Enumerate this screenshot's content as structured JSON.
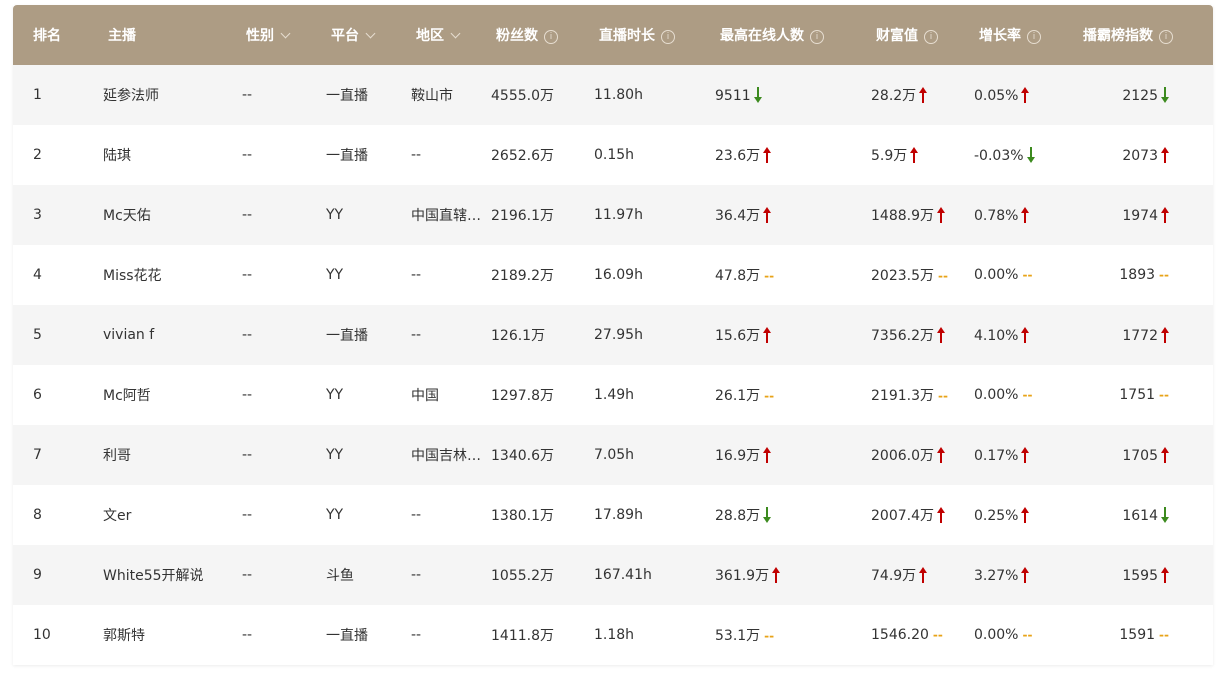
{
  "colors": {
    "header_bg": "#ad9c84",
    "up": "#c00000",
    "down": "#3c8a1e",
    "flat": "#e8a317"
  },
  "headers": {
    "rank": "排名",
    "anchor": "主播",
    "gender": "性别",
    "platform": "平台",
    "region": "地区",
    "fans": "粉丝数",
    "duration": "直播时长",
    "peak": "最高在线人数",
    "wealth": "财富值",
    "growth": "增长率",
    "index": "播霸榜指数"
  },
  "rows": [
    {
      "rank": "1",
      "anchor": "延参法师",
      "gender": "--",
      "platform": "一直播",
      "region": "鞍山市",
      "fans": "4555.0万",
      "duration": "11.80h",
      "peak": "9511",
      "peak_trend": "down",
      "wealth": "28.2万",
      "wealth_trend": "up",
      "growth": "0.05%",
      "growth_trend": "up",
      "index": "2125",
      "index_trend": "down"
    },
    {
      "rank": "2",
      "anchor": "陆琪",
      "gender": "--",
      "platform": "一直播",
      "region": "--",
      "fans": "2652.6万",
      "duration": "0.15h",
      "peak": "23.6万",
      "peak_trend": "up",
      "wealth": "5.9万",
      "wealth_trend": "up",
      "growth": "-0.03%",
      "growth_trend": "down",
      "index": "2073",
      "index_trend": "up"
    },
    {
      "rank": "3",
      "anchor": "Mc天佑",
      "gender": "--",
      "platform": "YY",
      "region": "中国直辖…",
      "fans": "2196.1万",
      "duration": "11.97h",
      "peak": "36.4万",
      "peak_trend": "up",
      "wealth": "1488.9万",
      "wealth_trend": "up",
      "growth": "0.78%",
      "growth_trend": "up",
      "index": "1974",
      "index_trend": "up"
    },
    {
      "rank": "4",
      "anchor": "Miss花花",
      "gender": "--",
      "platform": "YY",
      "region": "--",
      "fans": "2189.2万",
      "duration": "16.09h",
      "peak": "47.8万",
      "peak_trend": "flat",
      "wealth": "2023.5万",
      "wealth_trend": "flat",
      "growth": "0.00%",
      "growth_trend": "flat",
      "index": "1893",
      "index_trend": "flat"
    },
    {
      "rank": "5",
      "anchor": "vivian f",
      "gender": "--",
      "platform": "一直播",
      "region": "--",
      "fans": "126.1万",
      "duration": "27.95h",
      "peak": "15.6万",
      "peak_trend": "up",
      "wealth": "7356.2万",
      "wealth_trend": "up",
      "growth": "4.10%",
      "growth_trend": "up",
      "index": "1772",
      "index_trend": "up"
    },
    {
      "rank": "6",
      "anchor": "Mc阿哲",
      "gender": "--",
      "platform": "YY",
      "region": "中国",
      "fans": "1297.8万",
      "duration": "1.49h",
      "peak": "26.1万",
      "peak_trend": "flat",
      "wealth": "2191.3万",
      "wealth_trend": "flat",
      "growth": "0.00%",
      "growth_trend": "flat",
      "index": "1751",
      "index_trend": "flat"
    },
    {
      "rank": "7",
      "anchor": "利哥",
      "gender": "--",
      "platform": "YY",
      "region": "中国吉林…",
      "fans": "1340.6万",
      "duration": "7.05h",
      "peak": "16.9万",
      "peak_trend": "up",
      "wealth": "2006.0万",
      "wealth_trend": "up",
      "growth": "0.17%",
      "growth_trend": "up",
      "index": "1705",
      "index_trend": "up"
    },
    {
      "rank": "8",
      "anchor": "文er",
      "gender": "--",
      "platform": "YY",
      "region": "--",
      "fans": "1380.1万",
      "duration": "17.89h",
      "peak": "28.8万",
      "peak_trend": "down",
      "wealth": "2007.4万",
      "wealth_trend": "up",
      "growth": "0.25%",
      "growth_trend": "up",
      "index": "1614",
      "index_trend": "down"
    },
    {
      "rank": "9",
      "anchor": "White55开解说",
      "gender": "--",
      "platform": "斗鱼",
      "region": "--",
      "fans": "1055.2万",
      "duration": "167.41h",
      "peak": "361.9万",
      "peak_trend": "up",
      "wealth": "74.9万",
      "wealth_trend": "up",
      "growth": "3.27%",
      "growth_trend": "up",
      "index": "1595",
      "index_trend": "up"
    },
    {
      "rank": "10",
      "anchor": "郭斯特",
      "gender": "--",
      "platform": "一直播",
      "region": "--",
      "fans": "1411.8万",
      "duration": "1.18h",
      "peak": "53.1万",
      "peak_trend": "flat",
      "wealth": "1546.20",
      "wealth_trend": "flat",
      "growth": "0.00%",
      "growth_trend": "flat",
      "index": "1591",
      "index_trend": "flat"
    }
  ]
}
